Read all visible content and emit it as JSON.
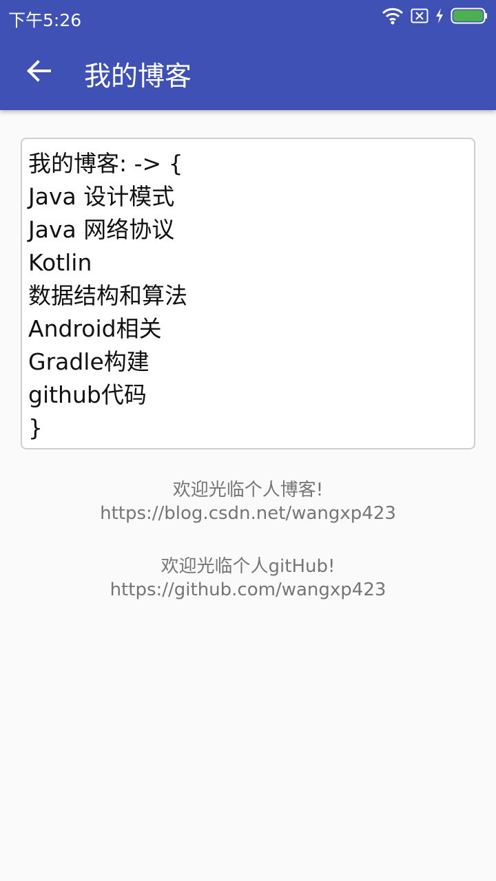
{
  "status_bar": {
    "time": "下午5:26",
    "icons": [
      "wifi-icon",
      "sim-no-signal-icon",
      "charging-icon",
      "battery-icon"
    ],
    "battery_color": "#4caf50"
  },
  "toolbar": {
    "title": "我的博客",
    "back_icon": "arrow-back-icon",
    "background_color": "#3f51b5"
  },
  "editor": {
    "lines": [
      "我的博客: -> {",
      "Java 设计模式",
      "Java 网络协议",
      "Kotlin",
      "数据结构和算法",
      "Android相关",
      "Gradle构建",
      "github代码",
      "}"
    ]
  },
  "blog_info": {
    "welcome": "欢迎光临个人博客!",
    "url": "https://blog.csdn.net/wangxp423"
  },
  "github_info": {
    "welcome": "欢迎光临个人gitHub!",
    "url": "https://github.com/wangxp423"
  }
}
